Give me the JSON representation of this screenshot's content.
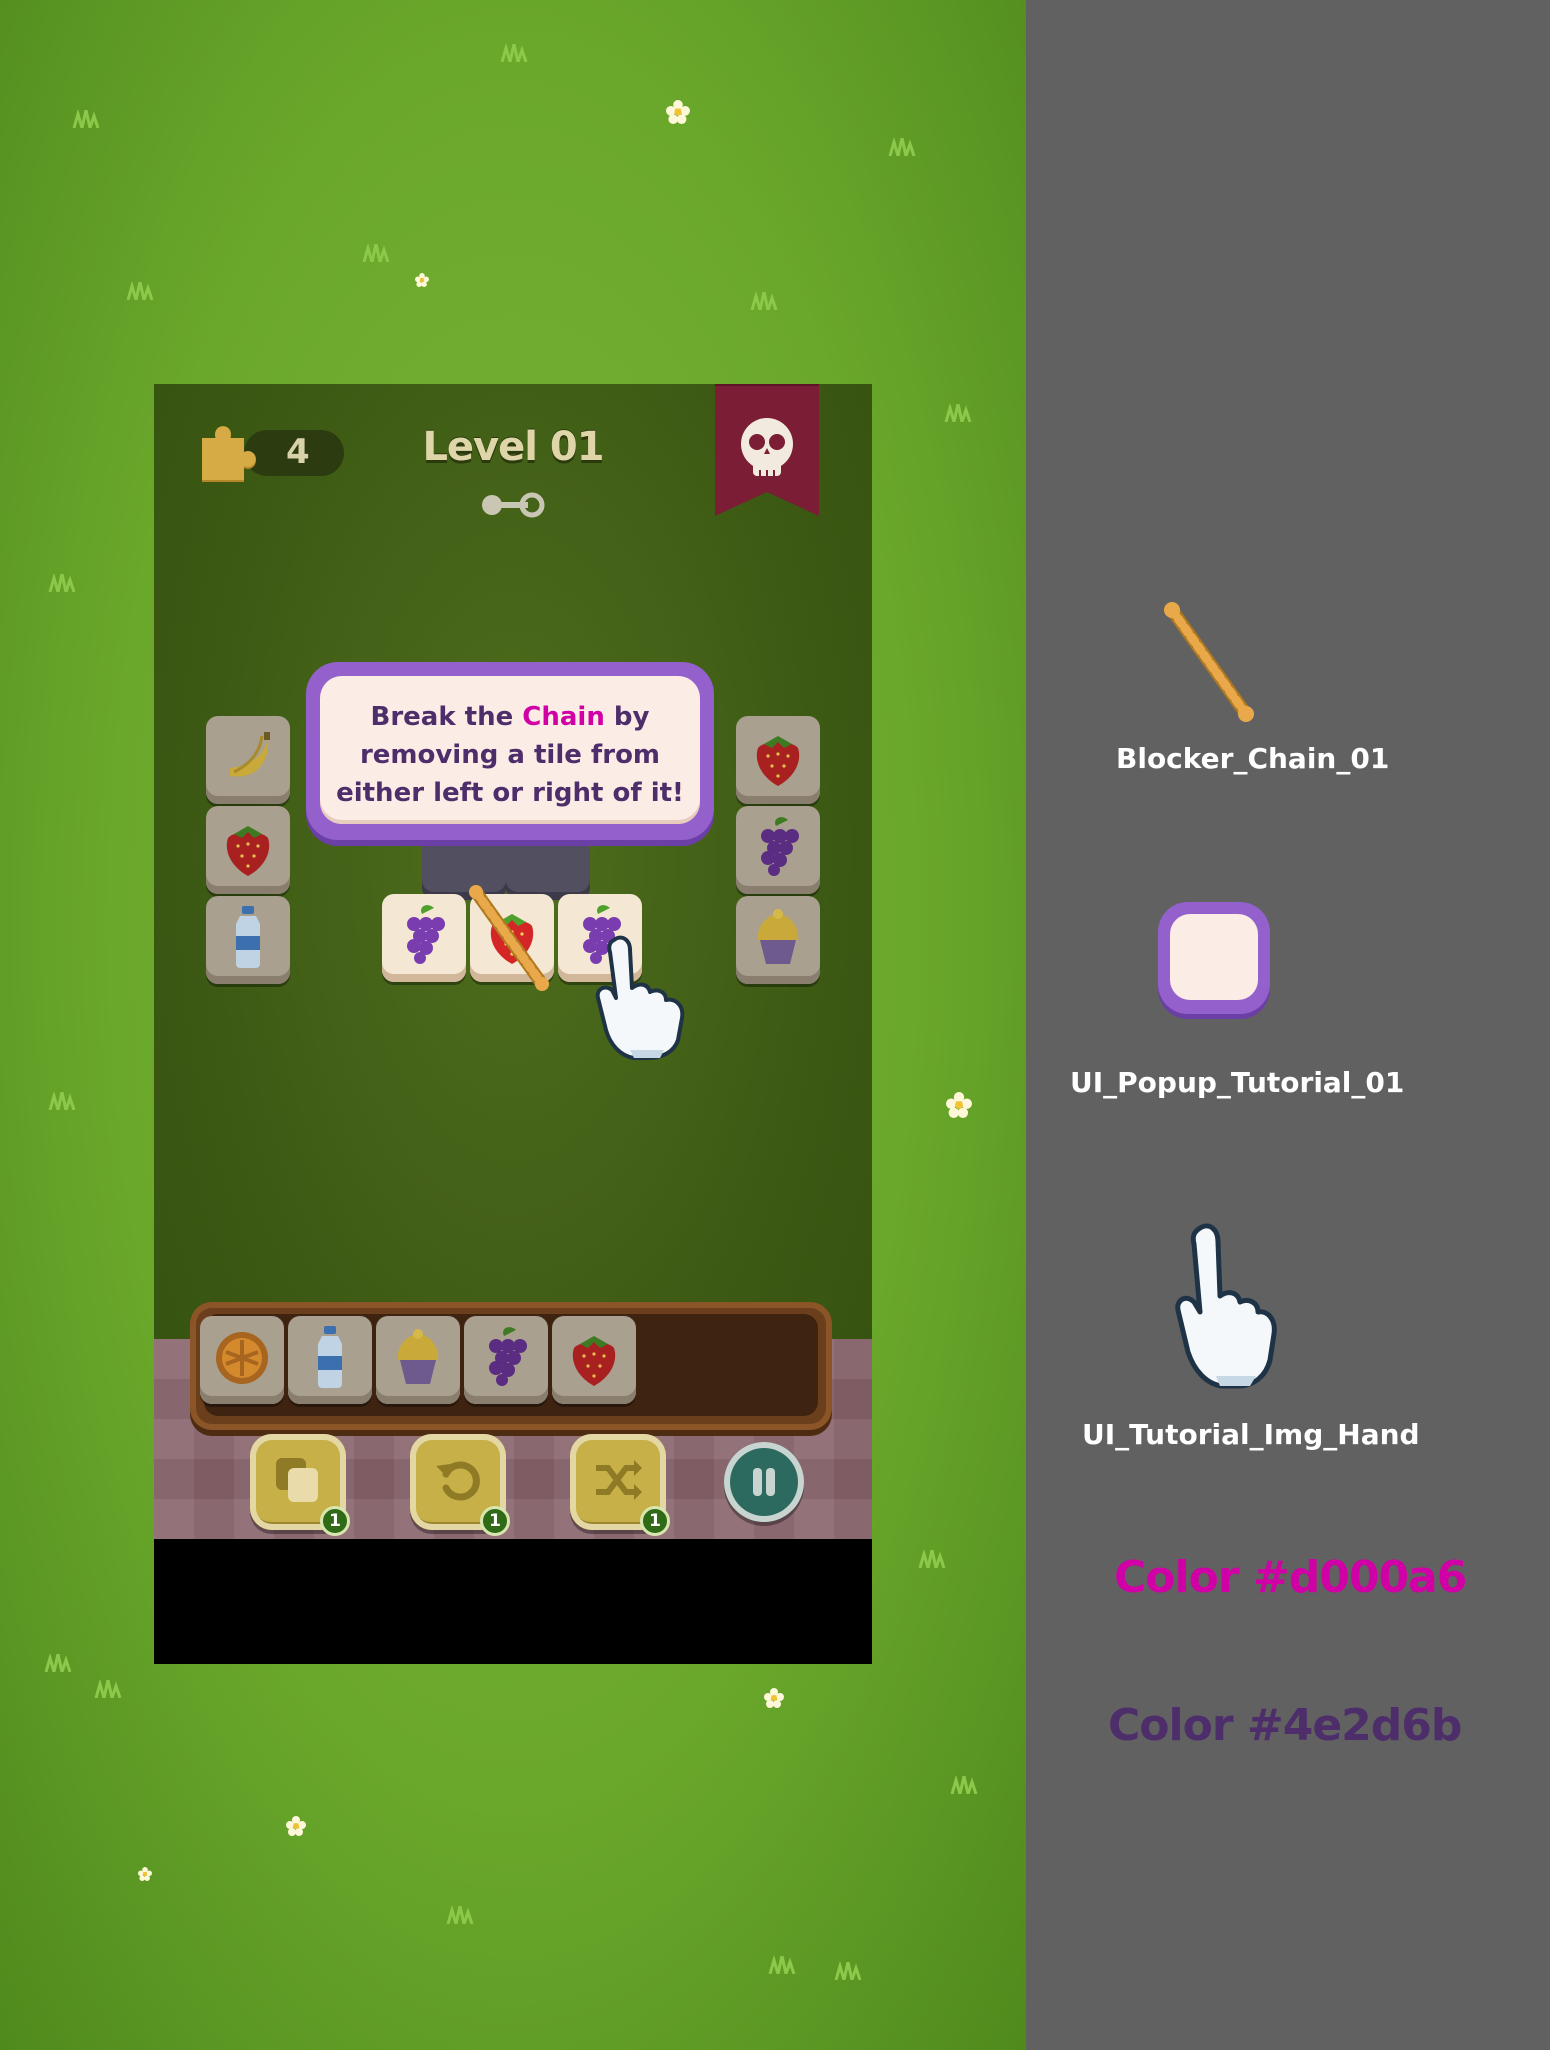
{
  "hud": {
    "puzzle_count": "4",
    "level_title": "Level 01"
  },
  "tutorial_popup": {
    "line1_a": "Break the ",
    "line1_chain": "Chain",
    "line1_b": " by",
    "line2": "removing a tile from",
    "line3": "either left or right of it!"
  },
  "board": {
    "left_column": [
      "banana",
      "strawberry",
      "water-bottle"
    ],
    "right_column": [
      "strawberry",
      "grapes",
      "cupcake"
    ],
    "center_row": [
      "grapes",
      "strawberry",
      "grapes"
    ]
  },
  "tray": {
    "tiles": [
      "pie",
      "water-bottle",
      "cupcake",
      "grapes",
      "strawberry"
    ],
    "capacity_slots": 7
  },
  "powerups": [
    {
      "name": "undo-stack",
      "icon": "tiles-stack-icon",
      "count": "1"
    },
    {
      "name": "undo",
      "icon": "undo-arrow-icon",
      "count": "1"
    },
    {
      "name": "shuffle",
      "icon": "shuffle-icon",
      "count": "1"
    }
  ],
  "assets": {
    "chain_label": "Blocker_Chain_01",
    "popup_label": "UI_Popup_Tutorial_01",
    "hand_label": "UI_Tutorial_Img_Hand"
  },
  "colors": {
    "chain_text_label": "Color #d000a6",
    "body_text_label": "Color #4e2d6b",
    "chain_text": "#d000a6",
    "body_text": "#4e2d6b"
  }
}
